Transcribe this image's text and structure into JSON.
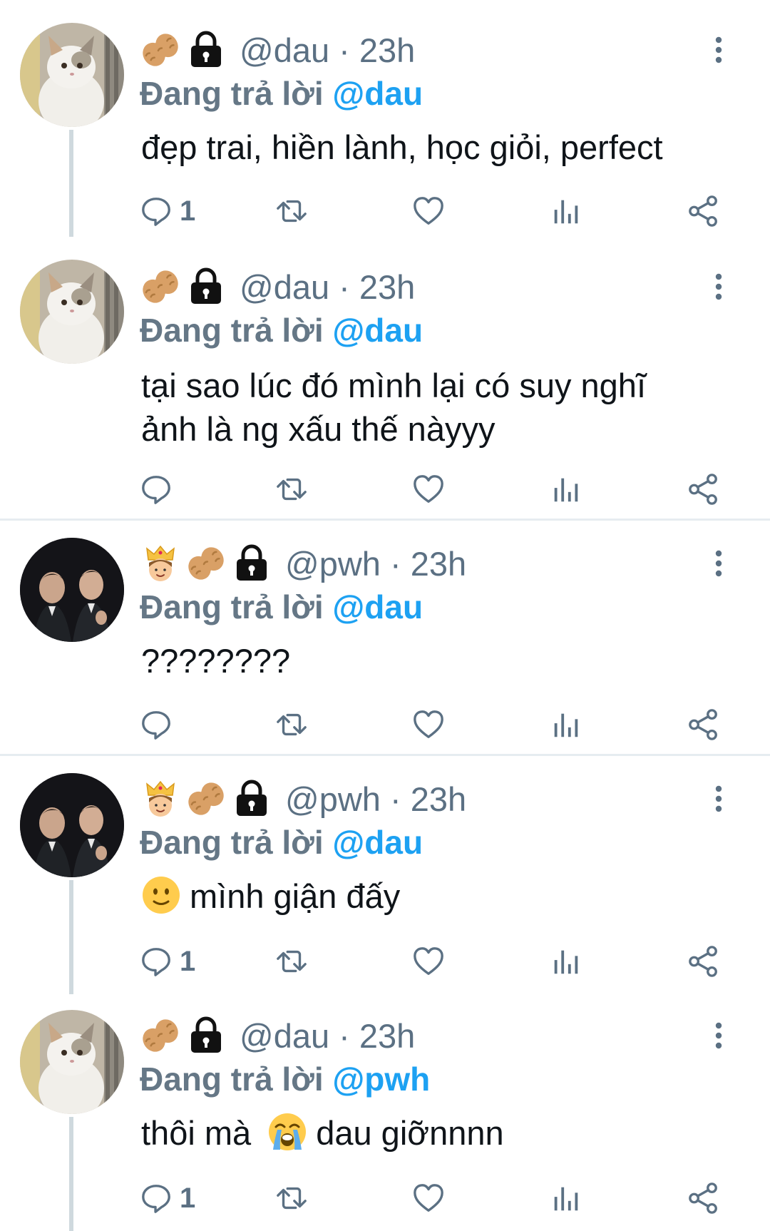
{
  "tweets": [
    {
      "account": "dau",
      "icons": [
        "peanut-icon",
        "lock-icon"
      ],
      "handle_time": "@dau · 23h",
      "replying_prefix": "Đang trả lời",
      "replying_to": "@dau",
      "text_lines": [
        "đẹp trai, hiền lành, học giỏi, perfect"
      ],
      "reply_count": "1"
    },
    {
      "account": "dau",
      "icons": [
        "peanut-icon",
        "lock-icon"
      ],
      "handle_time": "@dau · 23h",
      "replying_prefix": "Đang trả lời",
      "replying_to": "@dau",
      "text_lines": [
        "tại sao lúc đó mình lại có suy nghĩ",
        "ảnh là ng xấu thế nàyyy"
      ],
      "reply_count": ""
    },
    {
      "account": "pwh",
      "icons": [
        "prince-icon",
        "peanut-icon",
        "lock-icon"
      ],
      "handle_time": "@pwh · 23h",
      "replying_prefix": "Đang trả lời",
      "replying_to": "@dau",
      "text_lines": [
        "????????"
      ],
      "reply_count": ""
    },
    {
      "account": "pwh",
      "icons": [
        "prince-icon",
        "peanut-icon",
        "lock-icon"
      ],
      "handle_time": "@pwh · 23h",
      "replying_prefix": "Đang trả lời",
      "replying_to": "@dau",
      "text_lines": [
        "mình giận đấy"
      ],
      "text_emoji": "slight-smile-emoji",
      "reply_count": "1"
    },
    {
      "account": "dau",
      "icons": [
        "peanut-icon",
        "lock-icon"
      ],
      "handle_time": "@dau · 23h",
      "replying_prefix": "Đang trả lời",
      "replying_to": "@pwh",
      "text_before": "thôi mà",
      "text_emoji": "loudly-crying-emoji",
      "text_after": "dau giỡnnnn",
      "reply_count": "1"
    }
  ],
  "action_icons": [
    "reply-icon",
    "retweet-icon",
    "like-icon",
    "analytics-icon",
    "share-icon"
  ],
  "colors": {
    "mention": "#1da1f2",
    "secondary": "#5b7083",
    "thread_line": "#cfd9de",
    "divider": "#e6ecf0"
  }
}
